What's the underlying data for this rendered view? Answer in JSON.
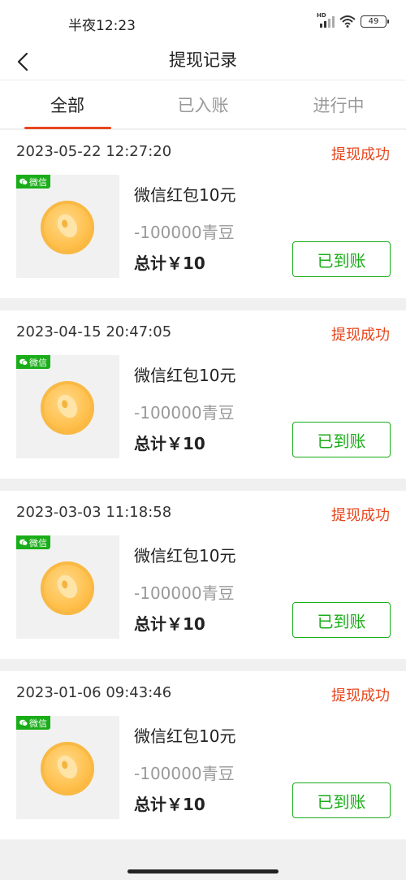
{
  "status_bar": {
    "time": "半夜12:23",
    "battery": "49",
    "signal_label": "HD"
  },
  "nav": {
    "title": "提现记录"
  },
  "tabs": [
    {
      "label": "全部",
      "active": true
    },
    {
      "label": "已入账",
      "active": false
    },
    {
      "label": "进行中",
      "active": false
    }
  ],
  "records": [
    {
      "date": "2023-05-22 12:27:20",
      "status": "提现成功",
      "badge": "微信",
      "name": "微信红包10元",
      "cost": "-100000青豆",
      "total": "总计￥10",
      "button": "已到账"
    },
    {
      "date": "2023-04-15 20:47:05",
      "status": "提现成功",
      "badge": "微信",
      "name": "微信红包10元",
      "cost": "-100000青豆",
      "total": "总计￥10",
      "button": "已到账"
    },
    {
      "date": "2023-03-03 11:18:58",
      "status": "提现成功",
      "badge": "微信",
      "name": "微信红包10元",
      "cost": "-100000青豆",
      "total": "总计￥10",
      "button": "已到账"
    },
    {
      "date": "2023-01-06 09:43:46",
      "status": "提现成功",
      "badge": "微信",
      "name": "微信红包10元",
      "cost": "-100000青豆",
      "total": "总计￥10",
      "button": "已到账"
    }
  ],
  "colors": {
    "accent": "#e8461c",
    "wechat_green": "#1aad19"
  }
}
